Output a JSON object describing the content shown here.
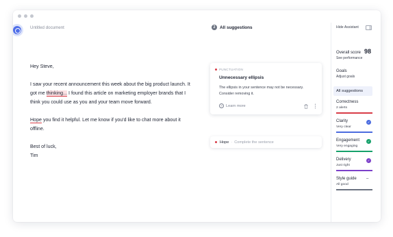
{
  "app": {
    "doc_title": "Untitled document"
  },
  "document": {
    "greeting": "Hey Steve,",
    "p1_before": "I saw your recent announcement this week about the big product launch. It got me ",
    "p1_flag": "thinking...",
    "p1_after": " I found this article on marketing employer brands that I think you could use as you and your team move forward.",
    "p2_flag": "Hope",
    "p2_after": " you find it helpful. Let me know if you'd like to chat more about it offline.",
    "closing": "Best of luck,",
    "signature": "Tim"
  },
  "suggestions_panel": {
    "count": "2",
    "heading": "All suggestions",
    "card": {
      "category": "PUNCTUATION",
      "title": "Unnecessary ellipsis",
      "description": "The ellipsis in your sentence may not be necessary. Consider removing it.",
      "learn_more": "Learn more",
      "icons": [
        "help-icon",
        "trash-icon",
        "more-icon"
      ]
    },
    "collapsed_card": {
      "word": "Hope",
      "separator": "·",
      "hint": "Complete the sentence"
    }
  },
  "sidebar": {
    "hide_label": "Hide Assistant",
    "overall_score_label": "Overall score",
    "overall_score_value": "98",
    "see_performance": "See performance",
    "goals_label": "Goals",
    "goals_sub": "Adjust goals",
    "all_suggestions": "All suggestions",
    "categories": [
      {
        "name": "Correctness",
        "sub": "2 alerts",
        "color": "#d83b46",
        "status": "none"
      },
      {
        "name": "Clarity",
        "sub": "Very clear",
        "color": "#4a6bdf",
        "status": "check"
      },
      {
        "name": "Engagement",
        "sub": "Very engaging",
        "color": "#15a06a",
        "status": "check"
      },
      {
        "name": "Delivery",
        "sub": "Just right",
        "color": "#7b3fc9",
        "status": "check"
      },
      {
        "name": "Style guide",
        "sub": "All good",
        "color": "#6b7280",
        "status": "dash",
        "symbol": "–"
      }
    ]
  },
  "colors": {
    "accent": "#4f6ee8",
    "alert": "#d83b46"
  }
}
